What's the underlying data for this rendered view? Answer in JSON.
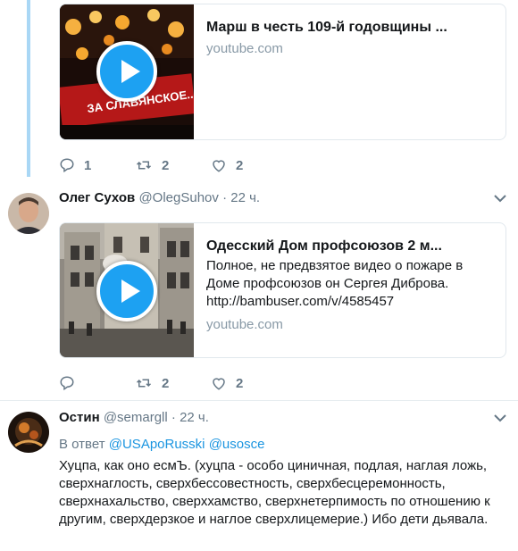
{
  "tweets": [
    {
      "card": {
        "title": "Марш в честь 109-й годовщины ...",
        "domain": "youtube.com",
        "thumb_caption": "ЗА СЛАВЯНСКОЕ..."
      },
      "actions": {
        "replies": "1",
        "retweets": "2",
        "likes": "2"
      }
    },
    {
      "author_name": "Олег Сухов",
      "author_handle": "@OlegSuhov",
      "separator": "·",
      "time": "22 ч.",
      "card": {
        "title": "Одесский Дом профсоюзов 2 м...",
        "description": "Полное, не предвзятое видео о пожаре в Доме профсоюзов он Сергея Диброва. http://bambuser.com/v/4585457",
        "domain": "youtube.com"
      },
      "actions": {
        "replies": "",
        "retweets": "2",
        "likes": "2"
      }
    },
    {
      "author_name": "Остин",
      "author_handle": "@semargll",
      "separator": "·",
      "time": "22 ч.",
      "reply_prefix": "В ответ",
      "reply_mentions": [
        "@USApoRusski",
        "@usosce"
      ],
      "text": "Хуцпа, как оно есмЪ. (хуцпа - особо циничная, подлая, наглая ложь, сверхнаглость, сверхбессовестность, сверхбесцеремонность, сверхнахальство, сверххамство, сверхнетерпимость по отношению к другим, сверхдерзкое и наглое сверхлицемерие.) Ибо дети дьявала."
    }
  ],
  "colors": {
    "accent": "#1da1f2",
    "mention": "#1b95e0",
    "muted": "#657786",
    "thread": "#a9d7f5"
  },
  "icons": [
    "reply-icon",
    "retweet-icon",
    "like-icon",
    "chevron-down-icon",
    "play-icon"
  ]
}
